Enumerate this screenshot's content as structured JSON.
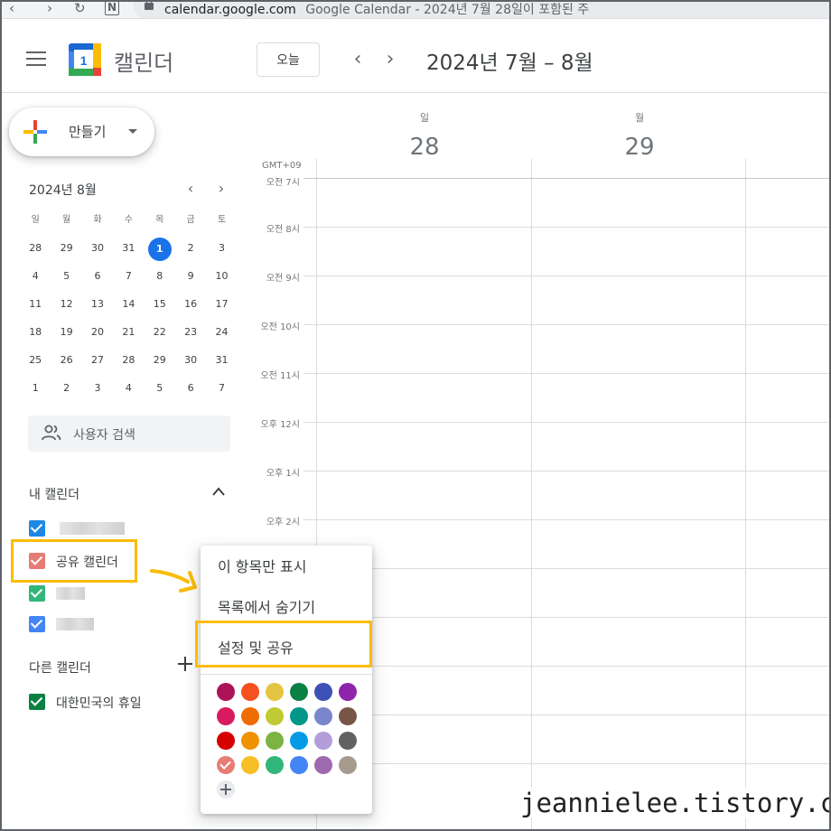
{
  "browser": {
    "url_domain": "calendar.google.com",
    "page_title": "Google Calendar - 2024년 7월 28일이 포함된 주",
    "back_glyph": "‹",
    "forward_glyph": "›",
    "reload_glyph": "↻",
    "ext_glyph": "N"
  },
  "header": {
    "app_title": "캘린더",
    "logo_number": "1",
    "today_label": "오늘",
    "prev_glyph": "‹",
    "next_glyph": "›",
    "date_range": "2024년 7월 – 8월"
  },
  "create": {
    "label": "만들기"
  },
  "mini_calendar": {
    "title": "2024년 8월",
    "prev_glyph": "‹",
    "next_glyph": "›",
    "weekdays": [
      "일",
      "월",
      "화",
      "수",
      "목",
      "금",
      "토"
    ],
    "weeks": [
      [
        "28",
        "29",
        "30",
        "31",
        "1",
        "2",
        "3"
      ],
      [
        "4",
        "5",
        "6",
        "7",
        "8",
        "9",
        "10"
      ],
      [
        "11",
        "12",
        "13",
        "14",
        "15",
        "16",
        "17"
      ],
      [
        "18",
        "19",
        "20",
        "21",
        "22",
        "23",
        "24"
      ],
      [
        "25",
        "26",
        "27",
        "28",
        "29",
        "30",
        "31"
      ],
      [
        "1",
        "2",
        "3",
        "4",
        "5",
        "6",
        "7"
      ]
    ],
    "today": "1"
  },
  "search_people": {
    "label": "사용자 검색"
  },
  "my_calendars": {
    "title": "내 캘린더",
    "items": [
      {
        "label": "",
        "color": "#1e88e5"
      },
      {
        "label": "공유 캘린더",
        "color": "#e67c73"
      },
      {
        "label": "",
        "color": "#33b679"
      },
      {
        "label": "",
        "color": "#4285f4"
      }
    ]
  },
  "other_calendars": {
    "title": "다른 캘린더",
    "items": [
      {
        "label": "대한민국의 휴일",
        "color": "#0b8043"
      }
    ]
  },
  "week": {
    "days": [
      {
        "name": "일",
        "number": "28"
      },
      {
        "name": "월",
        "number": "29"
      }
    ],
    "timezone": "GMT+09",
    "hours": [
      "오전 7시",
      "오전 8시",
      "오전 9시",
      "오전 10시",
      "오전 11시",
      "오후 12시",
      "오후 1시",
      "오후 2시"
    ]
  },
  "context_menu": {
    "items": [
      "이 항목만 표시",
      "목록에서 숨기기",
      "설정 및 공유"
    ],
    "highlighted": "설정 및 공유",
    "colors": [
      [
        "#ad1457",
        "#f4511e",
        "#e4c441",
        "#0b8043",
        "#3f51b5",
        "#8e24aa"
      ],
      [
        "#d81b60",
        "#ef6c00",
        "#c0ca33",
        "#009688",
        "#7986cb",
        "#795548"
      ],
      [
        "#d50000",
        "#f09300",
        "#7cb342",
        "#039be5",
        "#b39ddb",
        "#616161"
      ],
      [
        "#e67c73",
        "#f6bf26",
        "#33b679",
        "#4285f4",
        "#9e69af",
        "#a79b8e"
      ]
    ],
    "selected_color": "#e67c73"
  },
  "accent_colors": {
    "highlight": "#fbbc04",
    "today": "#1a73e8"
  },
  "watermark": "jeannielee.tistory.com"
}
